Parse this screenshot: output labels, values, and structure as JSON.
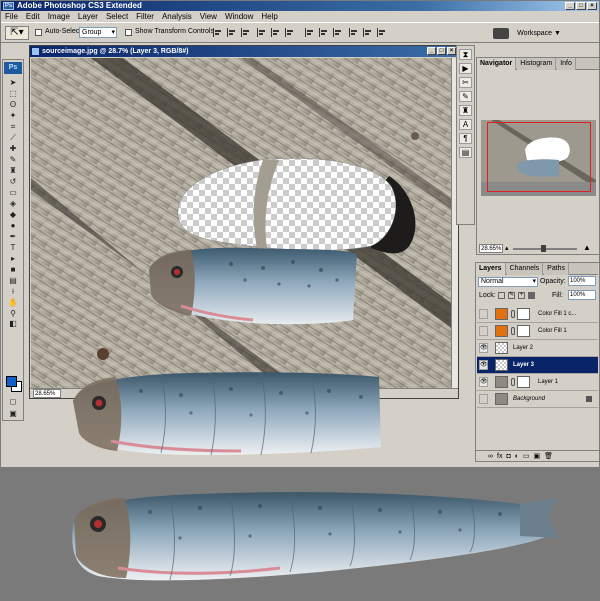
{
  "window": {
    "title": "Adobe Photoshop CS3 Extended",
    "badge": "Ps"
  },
  "menu": [
    "File",
    "Edit",
    "Image",
    "Layer",
    "Select",
    "Filter",
    "Analysis",
    "View",
    "Window",
    "Help"
  ],
  "options": {
    "auto_select_label": "Auto-Select:",
    "auto_select_value": "Group",
    "show_transform_label": "Show Transform Controls",
    "workspace_label": "Workspace ▼"
  },
  "toolbox": {
    "logo": "Ps",
    "foreground_color": "#1060c8",
    "background_color": "#ffffff"
  },
  "document": {
    "title": "sourceimage.jpg @ 28.7% (Layer 3, RGB/8#)",
    "zoom": "28.65%"
  },
  "navigator": {
    "tabs": [
      "Navigator",
      "Histogram",
      "Info"
    ],
    "zoom": "28.65%"
  },
  "layers": {
    "tabs": [
      "Layers",
      "Channels",
      "Paths"
    ],
    "blend_mode": "Normal",
    "opacity_label": "Opacity:",
    "opacity": "100%",
    "lock_label": "Lock:",
    "fill_label": "Fill:",
    "fill": "100%",
    "items": [
      {
        "name": "Color Fill 1 c...",
        "visible": false,
        "type": "fill"
      },
      {
        "name": "Color Fill 1",
        "visible": false,
        "type": "fill"
      },
      {
        "name": "Layer 2",
        "visible": true,
        "type": "pixel"
      },
      {
        "name": "Layer 3",
        "visible": true,
        "type": "pixel",
        "selected": true
      },
      {
        "name": "Layer 1",
        "visible": true,
        "type": "pixel-mask"
      },
      {
        "name": "Background",
        "visible": false,
        "type": "background",
        "locked": true
      }
    ]
  },
  "colors": {
    "accent_titlebar": "#0a246a",
    "selected_layer": "#0a246a",
    "fill_layer_swatch": "#e07010",
    "navigator_frame": "#e02020"
  }
}
